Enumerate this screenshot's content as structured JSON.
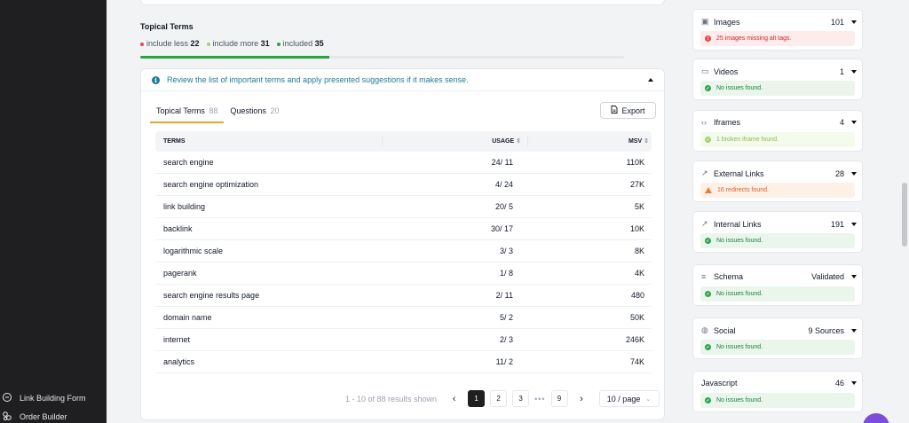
{
  "sidebar": {
    "items": [
      {
        "label": "Link Building Form",
        "icon": "link-building-icon"
      },
      {
        "label": "Order Builder",
        "icon": "order-builder-icon"
      }
    ]
  },
  "topical": {
    "title": "Topical Terms",
    "legend": [
      {
        "label": "include less",
        "count": "22",
        "color": "#e5484d"
      },
      {
        "label": "include more",
        "count": "31",
        "color": "#a3d16a"
      },
      {
        "label": "included",
        "count": "35",
        "color": "#22a83a"
      }
    ],
    "progress_fraction": 0.39
  },
  "card": {
    "info_text": "Review the list of important terms and apply presented suggestions if it makes sense.",
    "tabs": [
      {
        "label": "Topical Terms",
        "count": "88",
        "active": true
      },
      {
        "label": "Questions",
        "count": "20",
        "active": false
      }
    ],
    "export_label": "Export",
    "table": {
      "headers": {
        "terms": "TERMS",
        "usage": "USAGE",
        "msv": "MSV"
      },
      "rows": [
        {
          "term": "search engine",
          "usage": "24/ 11",
          "msv": "110K"
        },
        {
          "term": "search engine optimization",
          "usage": "4/ 24",
          "msv": "27K"
        },
        {
          "term": "link building",
          "usage": "20/ 5",
          "msv": "5K"
        },
        {
          "term": "backlink",
          "usage": "30/ 17",
          "msv": "10K"
        },
        {
          "term": "logarithmic scale",
          "usage": "3/ 3",
          "msv": "8K"
        },
        {
          "term": "pagerank",
          "usage": "1/ 8",
          "msv": "4K"
        },
        {
          "term": "search engine results page",
          "usage": "2/ 11",
          "msv": "480"
        },
        {
          "term": "domain name",
          "usage": "5/ 2",
          "msv": "50K"
        },
        {
          "term": "internet",
          "usage": "2/ 3",
          "msv": "246K"
        },
        {
          "term": "analytics",
          "usage": "11/ 2",
          "msv": "74K"
        }
      ]
    },
    "pagination": {
      "summary": "1 - 10 of 88 results shown",
      "prev": "‹",
      "pages": [
        "1",
        "2",
        "3"
      ],
      "dots": "•••",
      "last": "9",
      "next": "›",
      "per_page": "10 / page"
    }
  },
  "right_panel": {
    "cards": [
      {
        "name": "Images",
        "icon": "image-icon",
        "value": "101",
        "status": "25 images missing alt tags.",
        "status_type": "err"
      },
      {
        "name": "Videos",
        "icon": "video-icon",
        "value": "1",
        "status": "No issues found.",
        "status_type": "ok"
      },
      {
        "name": "Iframes",
        "icon": "code-icon",
        "value": "4",
        "status": "1 broken iframe found.",
        "status_type": "lite"
      },
      {
        "name": "External Links",
        "icon": "external-link-icon",
        "value": "28",
        "status": "16 redirects found.",
        "status_type": "warn"
      },
      {
        "name": "Internal Links",
        "icon": "internal-link-icon",
        "value": "191",
        "status": "No issues found.",
        "status_type": "ok"
      },
      {
        "name": "Schema",
        "icon": "list-icon",
        "value": "Validated",
        "status": "No issues found.",
        "status_type": "ok"
      },
      {
        "name": "Social",
        "icon": "social-icon",
        "value": "9 Sources",
        "status": "No issues found.",
        "status_type": "ok"
      },
      {
        "name": "Javascript",
        "icon": "",
        "value": "46",
        "status": "No issues found.",
        "status_type": "ok"
      }
    ]
  }
}
